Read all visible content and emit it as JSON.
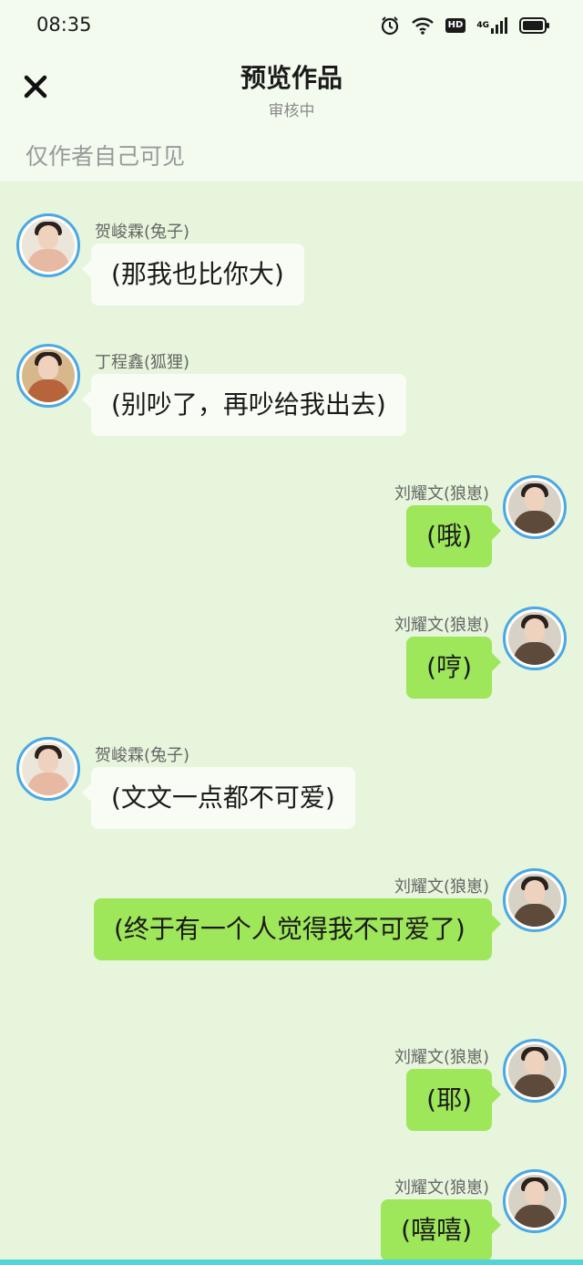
{
  "status_bar": {
    "time": "08:35",
    "icons": [
      "alarm-icon",
      "wifi-icon",
      "hd-icon",
      "signal-4g-icon",
      "battery-icon"
    ],
    "hd_label": "HD",
    "network_label": "4G"
  },
  "header": {
    "title": "预览作品",
    "subtitle": "审核中",
    "visibility_note": "仅作者自己可见"
  },
  "messages": [
    {
      "side": "left",
      "name": "贺峻霖(兔子)",
      "text": "(那我也比你大)",
      "avatar_color": "#e8b9a2"
    },
    {
      "side": "left",
      "name": "丁程鑫(狐狸)",
      "text": "(别吵了，再吵给我出去)",
      "avatar_color": "#b8643a"
    },
    {
      "side": "right",
      "name": "刘耀文(狼崽)",
      "text": "(哦)",
      "avatar_color": "#d9c9b1"
    },
    {
      "side": "right",
      "name": "刘耀文(狼崽)",
      "text": "(哼)",
      "avatar_color": "#d9c9b1"
    },
    {
      "side": "left",
      "name": "贺峻霖(兔子)",
      "text": "(文文一点都不可爱)",
      "avatar_color": "#e8b9a2"
    },
    {
      "side": "right",
      "name": "刘耀文(狼崽)",
      "text": "(终于有一个人觉得我不可爱了)",
      "avatar_color": "#d9c9b1"
    },
    {
      "side": "right",
      "name": "刘耀文(狼崽)",
      "text": "(耶)",
      "avatar_color": "#d9c9b1"
    },
    {
      "side": "right",
      "name": "刘耀文(狼崽)",
      "text": "(嘻嘻)",
      "avatar_color": "#d9c9b1"
    }
  ],
  "colors": {
    "chat_background": "#e6f5dc",
    "header_background": "#f3fbee",
    "right_bubble": "#9ee65a",
    "left_bubble": "#f8fcf4",
    "avatar_ring": "#4aa8e6"
  }
}
